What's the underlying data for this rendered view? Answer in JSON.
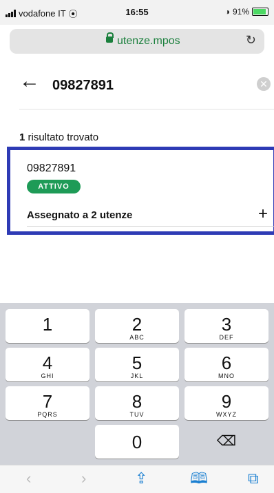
{
  "status_bar": {
    "carrier": "vodafone IT",
    "time": "16:55",
    "battery_percent": "91%"
  },
  "browser": {
    "url": "utenze.mpos",
    "reload_icon": "reload-icon"
  },
  "search": {
    "query": "09827891",
    "clear_icon": "clear-icon",
    "back_icon": "back-arrow-icon"
  },
  "results": {
    "count": "1",
    "count_label": " risultato trovato",
    "items": [
      {
        "number": "09827891",
        "status": "ATTIVO",
        "assigned_label": "Assegnato a 2 utenze",
        "status_color": "#1e9b57"
      }
    ]
  },
  "highlight_color": "#2e3bb5",
  "keyboard": {
    "keys": [
      {
        "num": "1",
        "letters": ""
      },
      {
        "num": "2",
        "letters": "ABC"
      },
      {
        "num": "3",
        "letters": "DEF"
      },
      {
        "num": "4",
        "letters": "GHI"
      },
      {
        "num": "5",
        "letters": "JKL"
      },
      {
        "num": "6",
        "letters": "MNO"
      },
      {
        "num": "7",
        "letters": "PQRS"
      },
      {
        "num": "8",
        "letters": "TUV"
      },
      {
        "num": "9",
        "letters": "WXYZ"
      },
      {
        "num": "0",
        "letters": ""
      }
    ]
  },
  "toolbar": {
    "icons": [
      "back-icon",
      "forward-icon",
      "share-icon",
      "bookmarks-icon",
      "tabs-icon"
    ]
  }
}
